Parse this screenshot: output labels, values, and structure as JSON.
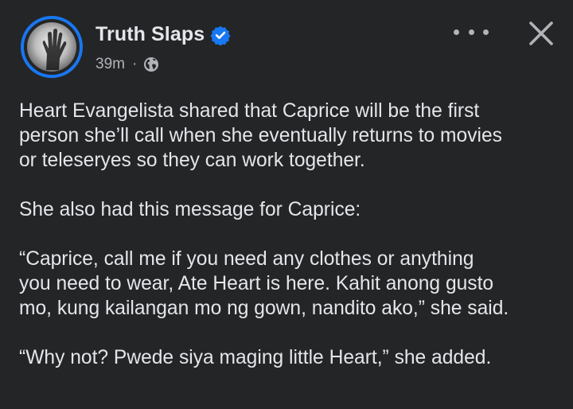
{
  "post": {
    "author": "Truth Slaps",
    "verified": true,
    "timestamp": "39m",
    "separator": "·",
    "audience_icon": "globe-icon",
    "paragraphs": [
      "Heart Evangelista shared that Caprice will be the first\nperson she’ll call when she eventually returns to movies\nor teleseryes so they can work together.",
      "She also had this message for Caprice:",
      "“Caprice, call me if you need any clothes or anything\nyou need to wear, Ate Heart is here. Kahit anong gusto\nmo, kung kailangan mo ng gown, nandito ako,” she said.",
      "“Why not? Pwede siya maging little Heart,” she added."
    ]
  },
  "icons": {
    "verified": "verified-badge-icon",
    "more": "more-options-icon",
    "close": "close-icon"
  },
  "colors": {
    "background": "#242526",
    "primary_text": "#e4e6eb",
    "secondary_text": "#b0b3b8",
    "accent": "#1877f2"
  }
}
